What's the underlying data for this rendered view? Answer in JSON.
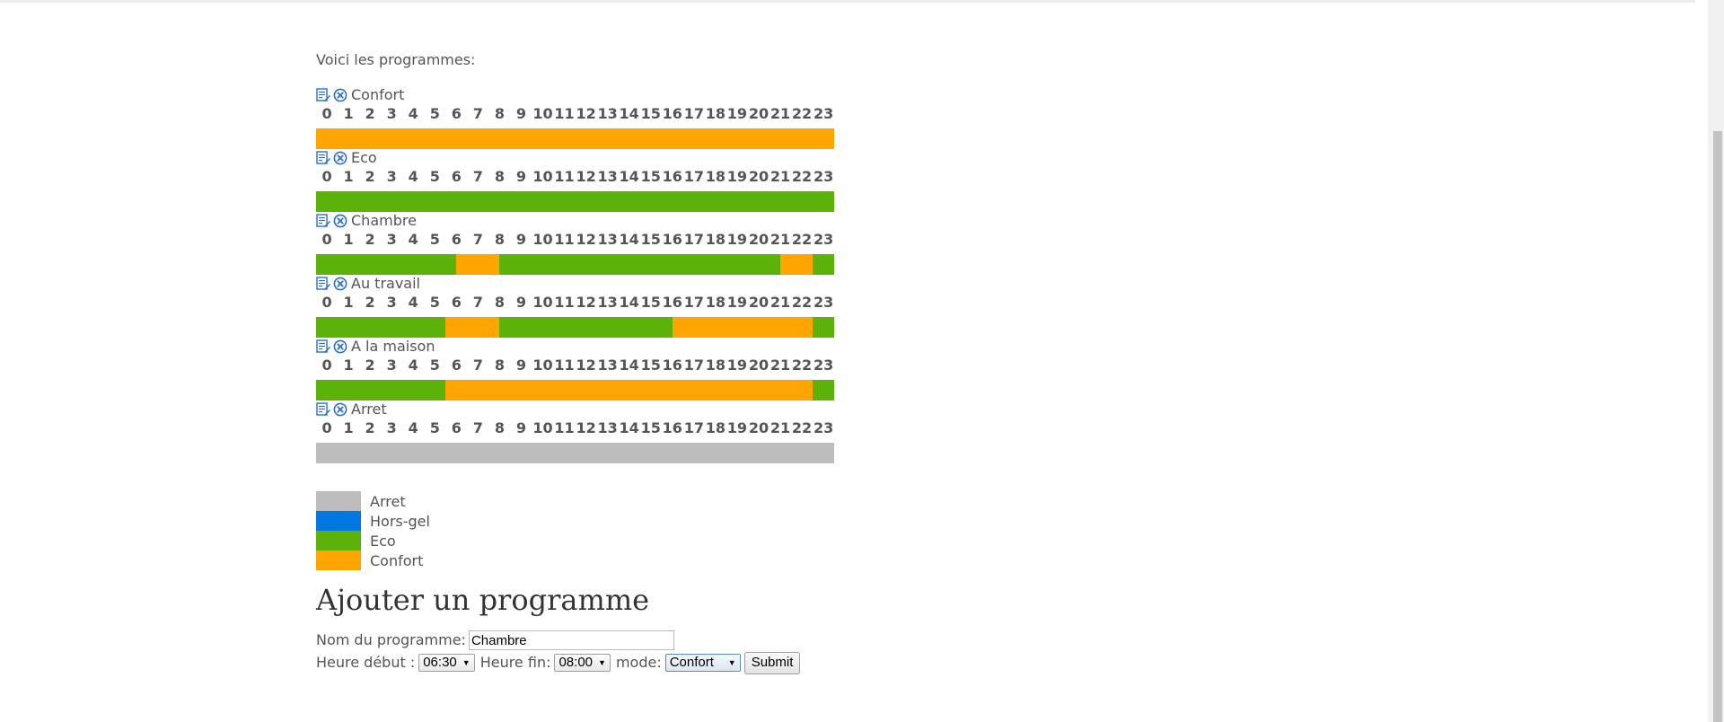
{
  "intro_text": "Voici les programmes:",
  "hours": [
    "0",
    "1",
    "2",
    "3",
    "4",
    "5",
    "6",
    "7",
    "8",
    "9",
    "10",
    "11",
    "12",
    "13",
    "14",
    "15",
    "16",
    "17",
    "18",
    "19",
    "20",
    "21",
    "22",
    "23"
  ],
  "colors": {
    "Arret": "#bdbdbd",
    "Hors-gel": "#0078e0",
    "Eco": "#5db20a",
    "Confort": "#ffa500"
  },
  "icons": {
    "edit": "edit-icon",
    "delete": "delete-icon"
  },
  "programs": [
    {
      "name": "Confort",
      "schedule": [
        "Confort",
        "Confort",
        "Confort",
        "Confort",
        "Confort",
        "Confort",
        "Confort",
        "Confort",
        "Confort",
        "Confort",
        "Confort",
        "Confort",
        "Confort",
        "Confort",
        "Confort",
        "Confort",
        "Confort",
        "Confort",
        "Confort",
        "Confort",
        "Confort",
        "Confort",
        "Confort",
        "Confort",
        "Confort",
        "Confort",
        "Confort",
        "Confort",
        "Confort",
        "Confort",
        "Confort",
        "Confort",
        "Confort",
        "Confort",
        "Confort",
        "Confort",
        "Confort",
        "Confort",
        "Confort",
        "Confort",
        "Confort",
        "Confort",
        "Confort",
        "Confort",
        "Confort",
        "Confort",
        "Confort",
        "Confort"
      ]
    },
    {
      "name": "Eco",
      "schedule": [
        "Eco",
        "Eco",
        "Eco",
        "Eco",
        "Eco",
        "Eco",
        "Eco",
        "Eco",
        "Eco",
        "Eco",
        "Eco",
        "Eco",
        "Eco",
        "Eco",
        "Eco",
        "Eco",
        "Eco",
        "Eco",
        "Eco",
        "Eco",
        "Eco",
        "Eco",
        "Eco",
        "Eco",
        "Eco",
        "Eco",
        "Eco",
        "Eco",
        "Eco",
        "Eco",
        "Eco",
        "Eco",
        "Eco",
        "Eco",
        "Eco",
        "Eco",
        "Eco",
        "Eco",
        "Eco",
        "Eco",
        "Eco",
        "Eco",
        "Eco",
        "Eco",
        "Eco",
        "Eco",
        "Eco",
        "Eco"
      ]
    },
    {
      "name": "Chambre",
      "schedule": [
        "Eco",
        "Eco",
        "Eco",
        "Eco",
        "Eco",
        "Eco",
        "Eco",
        "Eco",
        "Eco",
        "Eco",
        "Eco",
        "Eco",
        "Eco",
        "Confort",
        "Confort",
        "Confort",
        "Confort",
        "Eco",
        "Eco",
        "Eco",
        "Eco",
        "Eco",
        "Eco",
        "Eco",
        "Eco",
        "Eco",
        "Eco",
        "Eco",
        "Eco",
        "Eco",
        "Eco",
        "Eco",
        "Eco",
        "Eco",
        "Eco",
        "Eco",
        "Eco",
        "Eco",
        "Eco",
        "Eco",
        "Eco",
        "Eco",
        "Eco",
        "Confort",
        "Confort",
        "Confort",
        "Eco",
        "Eco"
      ]
    },
    {
      "name": "Au travail",
      "schedule": [
        "Eco",
        "Eco",
        "Eco",
        "Eco",
        "Eco",
        "Eco",
        "Eco",
        "Eco",
        "Eco",
        "Eco",
        "Eco",
        "Eco",
        "Confort",
        "Confort",
        "Confort",
        "Confort",
        "Confort",
        "Eco",
        "Eco",
        "Eco",
        "Eco",
        "Eco",
        "Eco",
        "Eco",
        "Eco",
        "Eco",
        "Eco",
        "Eco",
        "Eco",
        "Eco",
        "Eco",
        "Eco",
        "Eco",
        "Confort",
        "Confort",
        "Confort",
        "Confort",
        "Confort",
        "Confort",
        "Confort",
        "Confort",
        "Confort",
        "Confort",
        "Confort",
        "Confort",
        "Confort",
        "Eco",
        "Eco"
      ]
    },
    {
      "name": "A la maison",
      "schedule": [
        "Eco",
        "Eco",
        "Eco",
        "Eco",
        "Eco",
        "Eco",
        "Eco",
        "Eco",
        "Eco",
        "Eco",
        "Eco",
        "Eco",
        "Confort",
        "Confort",
        "Confort",
        "Confort",
        "Confort",
        "Confort",
        "Confort",
        "Confort",
        "Confort",
        "Confort",
        "Confort",
        "Confort",
        "Confort",
        "Confort",
        "Confort",
        "Confort",
        "Confort",
        "Confort",
        "Confort",
        "Confort",
        "Confort",
        "Confort",
        "Confort",
        "Confort",
        "Confort",
        "Confort",
        "Confort",
        "Confort",
        "Confort",
        "Confort",
        "Confort",
        "Confort",
        "Confort",
        "Confort",
        "Eco",
        "Eco"
      ]
    },
    {
      "name": "Arret",
      "schedule": [
        "Arret",
        "Arret",
        "Arret",
        "Arret",
        "Arret",
        "Arret",
        "Arret",
        "Arret",
        "Arret",
        "Arret",
        "Arret",
        "Arret",
        "Arret",
        "Arret",
        "Arret",
        "Arret",
        "Arret",
        "Arret",
        "Arret",
        "Arret",
        "Arret",
        "Arret",
        "Arret",
        "Arret",
        "Arret",
        "Arret",
        "Arret",
        "Arret",
        "Arret",
        "Arret",
        "Arret",
        "Arret",
        "Arret",
        "Arret",
        "Arret",
        "Arret",
        "Arret",
        "Arret",
        "Arret",
        "Arret",
        "Arret",
        "Arret",
        "Arret",
        "Arret",
        "Arret",
        "Arret",
        "Arret",
        "Arret"
      ]
    }
  ],
  "legend": [
    {
      "label": "Arret",
      "mode": "Arret"
    },
    {
      "label": "Hors-gel",
      "mode": "Hors-gel"
    },
    {
      "label": "Eco",
      "mode": "Eco"
    },
    {
      "label": "Confort",
      "mode": "Confort"
    }
  ],
  "form": {
    "heading": "Ajouter un programme",
    "name_label": "Nom du programme:",
    "name_value": "Chambre",
    "start_label": "Heure début :",
    "start_value": "06:30",
    "end_label": "Heure fin:",
    "end_value": "08:00",
    "mode_label": "mode:",
    "mode_value": "Confort",
    "submit_label": "Submit"
  }
}
